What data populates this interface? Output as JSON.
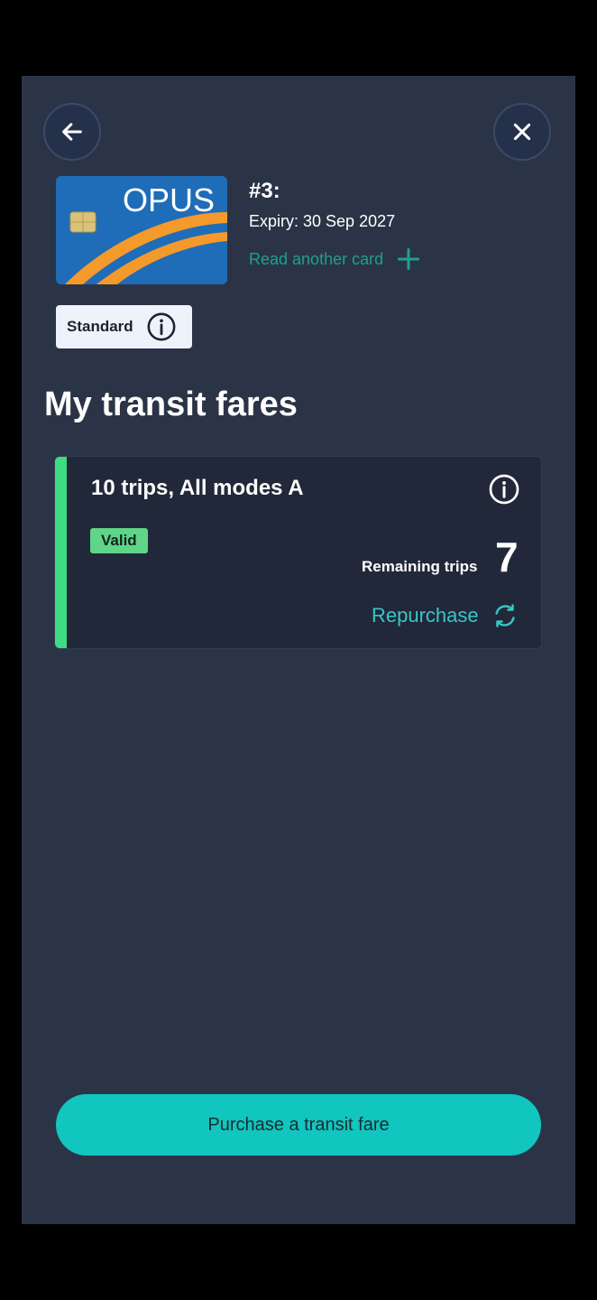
{
  "header": {
    "back_icon": "arrow-left-icon",
    "close_icon": "close-icon"
  },
  "card": {
    "brand": "OPUS",
    "number": "#3:",
    "expiry": "Expiry: 30 Sep 2027",
    "read_another_label": "Read another card",
    "read_another_icon": "plus-icon",
    "profile_label": "Standard",
    "profile_icon": "info-icon"
  },
  "section": {
    "title": "My transit fares"
  },
  "fare": {
    "name": "10 trips, All modes A",
    "status": "Valid",
    "remaining_label": "Remaining trips",
    "remaining_value": "7",
    "repurchase_label": "Repurchase",
    "repurchase_icon": "refresh-icon"
  },
  "footer": {
    "purchase_label": "Purchase a transit fare"
  },
  "colors": {
    "background": "#2b3446",
    "accent_teal": "#10c6be",
    "valid_green": "#5fd58a",
    "link_teal": "#1f9f8e"
  }
}
